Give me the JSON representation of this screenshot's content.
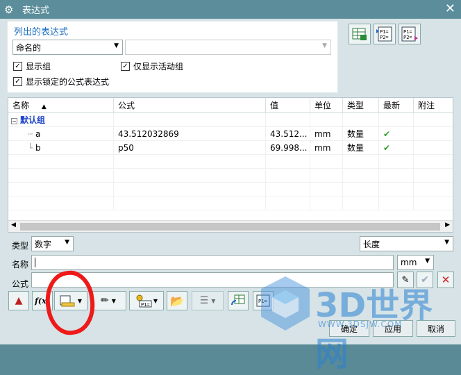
{
  "window": {
    "title": "表达式"
  },
  "list_section": {
    "title": "列出的表达式",
    "filter_select": "命名的",
    "filter_input": "",
    "show_groups_label": "显示组",
    "only_active_label": "仅显示活动组",
    "show_locked_label": "显示锁定的公式表达式"
  },
  "table": {
    "columns": [
      "名称",
      "公式",
      "值",
      "单位",
      "类型",
      "最新",
      "附注"
    ],
    "group": "默认组",
    "rows": [
      {
        "name": "a",
        "formula": "43.512032869",
        "value": "43.512...",
        "unit": "mm",
        "type": "数量"
      },
      {
        "name": "b",
        "formula": "p50",
        "value": "69.998...",
        "unit": "mm",
        "type": "数量"
      }
    ]
  },
  "editor": {
    "type_label": "类型",
    "type_value": "数字",
    "dimension_value": "长度",
    "name_label": "名称",
    "name_value": "",
    "unit_value": "mm",
    "formula_label": "公式",
    "formula_value": ""
  },
  "footer": {
    "ok": "确定",
    "apply": "应用",
    "cancel": "取消"
  },
  "watermark": {
    "brand": "3D世界网",
    "url": "WWW.3DSJW.COM"
  }
}
